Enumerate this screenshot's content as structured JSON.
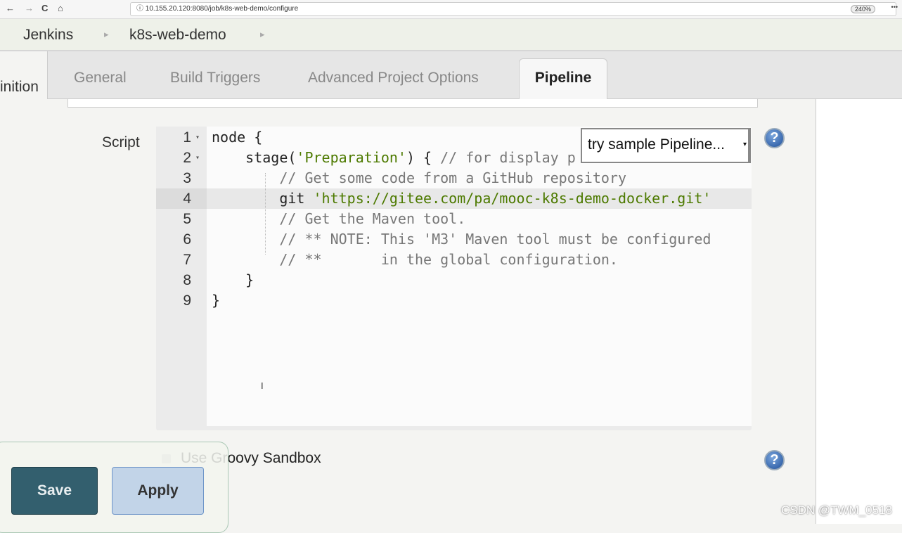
{
  "browser": {
    "url": "10.155.20.120:8080/job/k8s-web-demo/configure",
    "zoom": "240%",
    "back": "←",
    "forward": "→",
    "reload": "C",
    "home": "⌂",
    "more": "•••"
  },
  "breadcrumb": {
    "items": [
      "Jenkins",
      "k8s-web-demo"
    ],
    "sep": "▸"
  },
  "tabs": [
    "General",
    "Build Triggers",
    "Advanced Project Options",
    "Pipeline"
  ],
  "active_tab": "Pipeline",
  "definition_label": "inition",
  "script": {
    "label": "Script",
    "sample_select": "try sample Pipeline...",
    "lines": [
      {
        "n": "1",
        "fold": "▾",
        "tokens": [
          {
            "t": "node {",
            "k": ""
          }
        ]
      },
      {
        "n": "2",
        "fold": "▾",
        "tokens": [
          {
            "t": "    stage(",
            "k": ""
          },
          {
            "t": "'Preparation'",
            "k": "s"
          },
          {
            "t": ") { ",
            "k": ""
          },
          {
            "t": "// for display p",
            "k": "c"
          }
        ]
      },
      {
        "n": "3",
        "tokens": [
          {
            "t": "        // Get some code from a GitHub repository",
            "k": "c"
          }
        ]
      },
      {
        "n": "4",
        "tokens": [
          {
            "t": "        git ",
            "k": ""
          },
          {
            "t": "'https://gitee.com/pa/mooc-k8s-demo-docker.git'",
            "k": "s"
          }
        ]
      },
      {
        "n": "5",
        "tokens": [
          {
            "t": "        // Get the Maven tool.",
            "k": "c"
          }
        ]
      },
      {
        "n": "6",
        "tokens": [
          {
            "t": "        // ** NOTE: This 'M3' Maven tool must be configured",
            "k": "c"
          }
        ]
      },
      {
        "n": "7",
        "tokens": [
          {
            "t": "        // **       in the global configuration.",
            "k": "c"
          }
        ]
      },
      {
        "n": "8",
        "tokens": [
          {
            "t": "    }",
            "k": ""
          }
        ]
      },
      {
        "n": "9",
        "tokens": [
          {
            "t": "}",
            "k": ""
          }
        ]
      }
    ],
    "highlighted_line": 4
  },
  "sandbox": {
    "label": "Use Groovy Sandbox",
    "checked": true
  },
  "help": "?",
  "buttons": {
    "save": "Save",
    "apply": "Apply"
  },
  "watermark": "CSDN @TWM_0518"
}
